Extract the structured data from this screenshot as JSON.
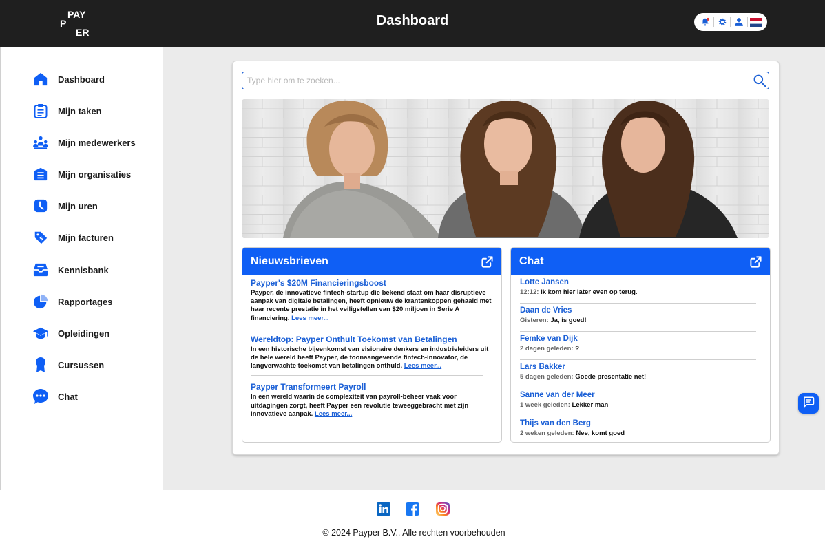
{
  "header": {
    "logo": [
      "P",
      "PAY",
      "ER"
    ],
    "title": "Dashboard",
    "icons": [
      "notification-icon",
      "settings-icon",
      "user-icon",
      "flag-nl-icon"
    ]
  },
  "sidebar": {
    "items": [
      {
        "label": "Dashboard",
        "icon": "home-icon"
      },
      {
        "label": "Mijn taken",
        "icon": "clipboard-icon"
      },
      {
        "label": "Mijn medewerkers",
        "icon": "team-icon"
      },
      {
        "label": "Mijn organisaties",
        "icon": "building-icon"
      },
      {
        "label": "Mijn uren",
        "icon": "clock-icon"
      },
      {
        "label": "Mijn facturen",
        "icon": "invoice-tag-icon"
      },
      {
        "label": "Kennisbank",
        "icon": "inbox-icon"
      },
      {
        "label": "Rapportages",
        "icon": "pie-chart-icon"
      },
      {
        "label": "Opleidingen",
        "icon": "graduation-cap-icon"
      },
      {
        "label": "Cursussen",
        "icon": "award-icon"
      },
      {
        "label": "Chat",
        "icon": "chat-bubble-icon"
      }
    ]
  },
  "search": {
    "placeholder": "Type hier om te zoeken..."
  },
  "news": {
    "title": "Nieuwsbrieven",
    "items": [
      {
        "title": "Payper's $20M Financieringsboost",
        "body": "Payper, de innovatieve fintech-startup die bekend staat om haar disruptieve aanpak van digitale betalingen, heeft opnieuw de krantenkoppen gehaald met haar recente prestatie in het veiligstellen van $20 miljoen in Serie A financiering.",
        "more": "Lees meer..."
      },
      {
        "title": "Wereldtop: Payper Onthult Toekomst van Betalingen",
        "body": "In een historische bijeenkomst van visionaire denkers en industrieleiders uit de hele wereld heeft Payper, de toonaangevende fintech-innovator, de langverwachte toekomst van betalingen onthuld.",
        "more": "Lees meer..."
      },
      {
        "title": "Payper Transformeert Payroll",
        "body": "In een wereld waarin de complexiteit van payroll-beheer vaak voor uitdagingen zorgt, heeft Payper een revolutie teweeggebracht met zijn innovatieve aanpak.",
        "more": "Lees meer..."
      }
    ]
  },
  "chat": {
    "title": "Chat",
    "items": [
      {
        "name": "Lotte Jansen",
        "time": "12:12:",
        "message": "Ik kom hier later even op terug."
      },
      {
        "name": "Daan de Vries",
        "time": "Gisteren:",
        "message": "Ja, is goed!"
      },
      {
        "name": "Femke van Dijk",
        "time": "2 dagen geleden:",
        "message": "?"
      },
      {
        "name": "Lars Bakker",
        "time": "5 dagen geleden:",
        "message": "Goede presentatie net!"
      },
      {
        "name": "Sanne van der Meer",
        "time": "1 week geleden:",
        "message": "Lekker man"
      },
      {
        "name": "Thijs van den Berg",
        "time": "2 weken geleden:",
        "message": "Nee, komt goed"
      }
    ]
  },
  "footer": {
    "social": [
      "linkedin-icon",
      "facebook-icon",
      "instagram-icon"
    ],
    "copyright": "© 2024 Payper B.V.. Alle rechten voorbehouden"
  },
  "colors": {
    "accent": "#0f5ff5",
    "link": "#1a5fd6",
    "topbar": "#1f1f1f",
    "background": "#ebebeb"
  }
}
